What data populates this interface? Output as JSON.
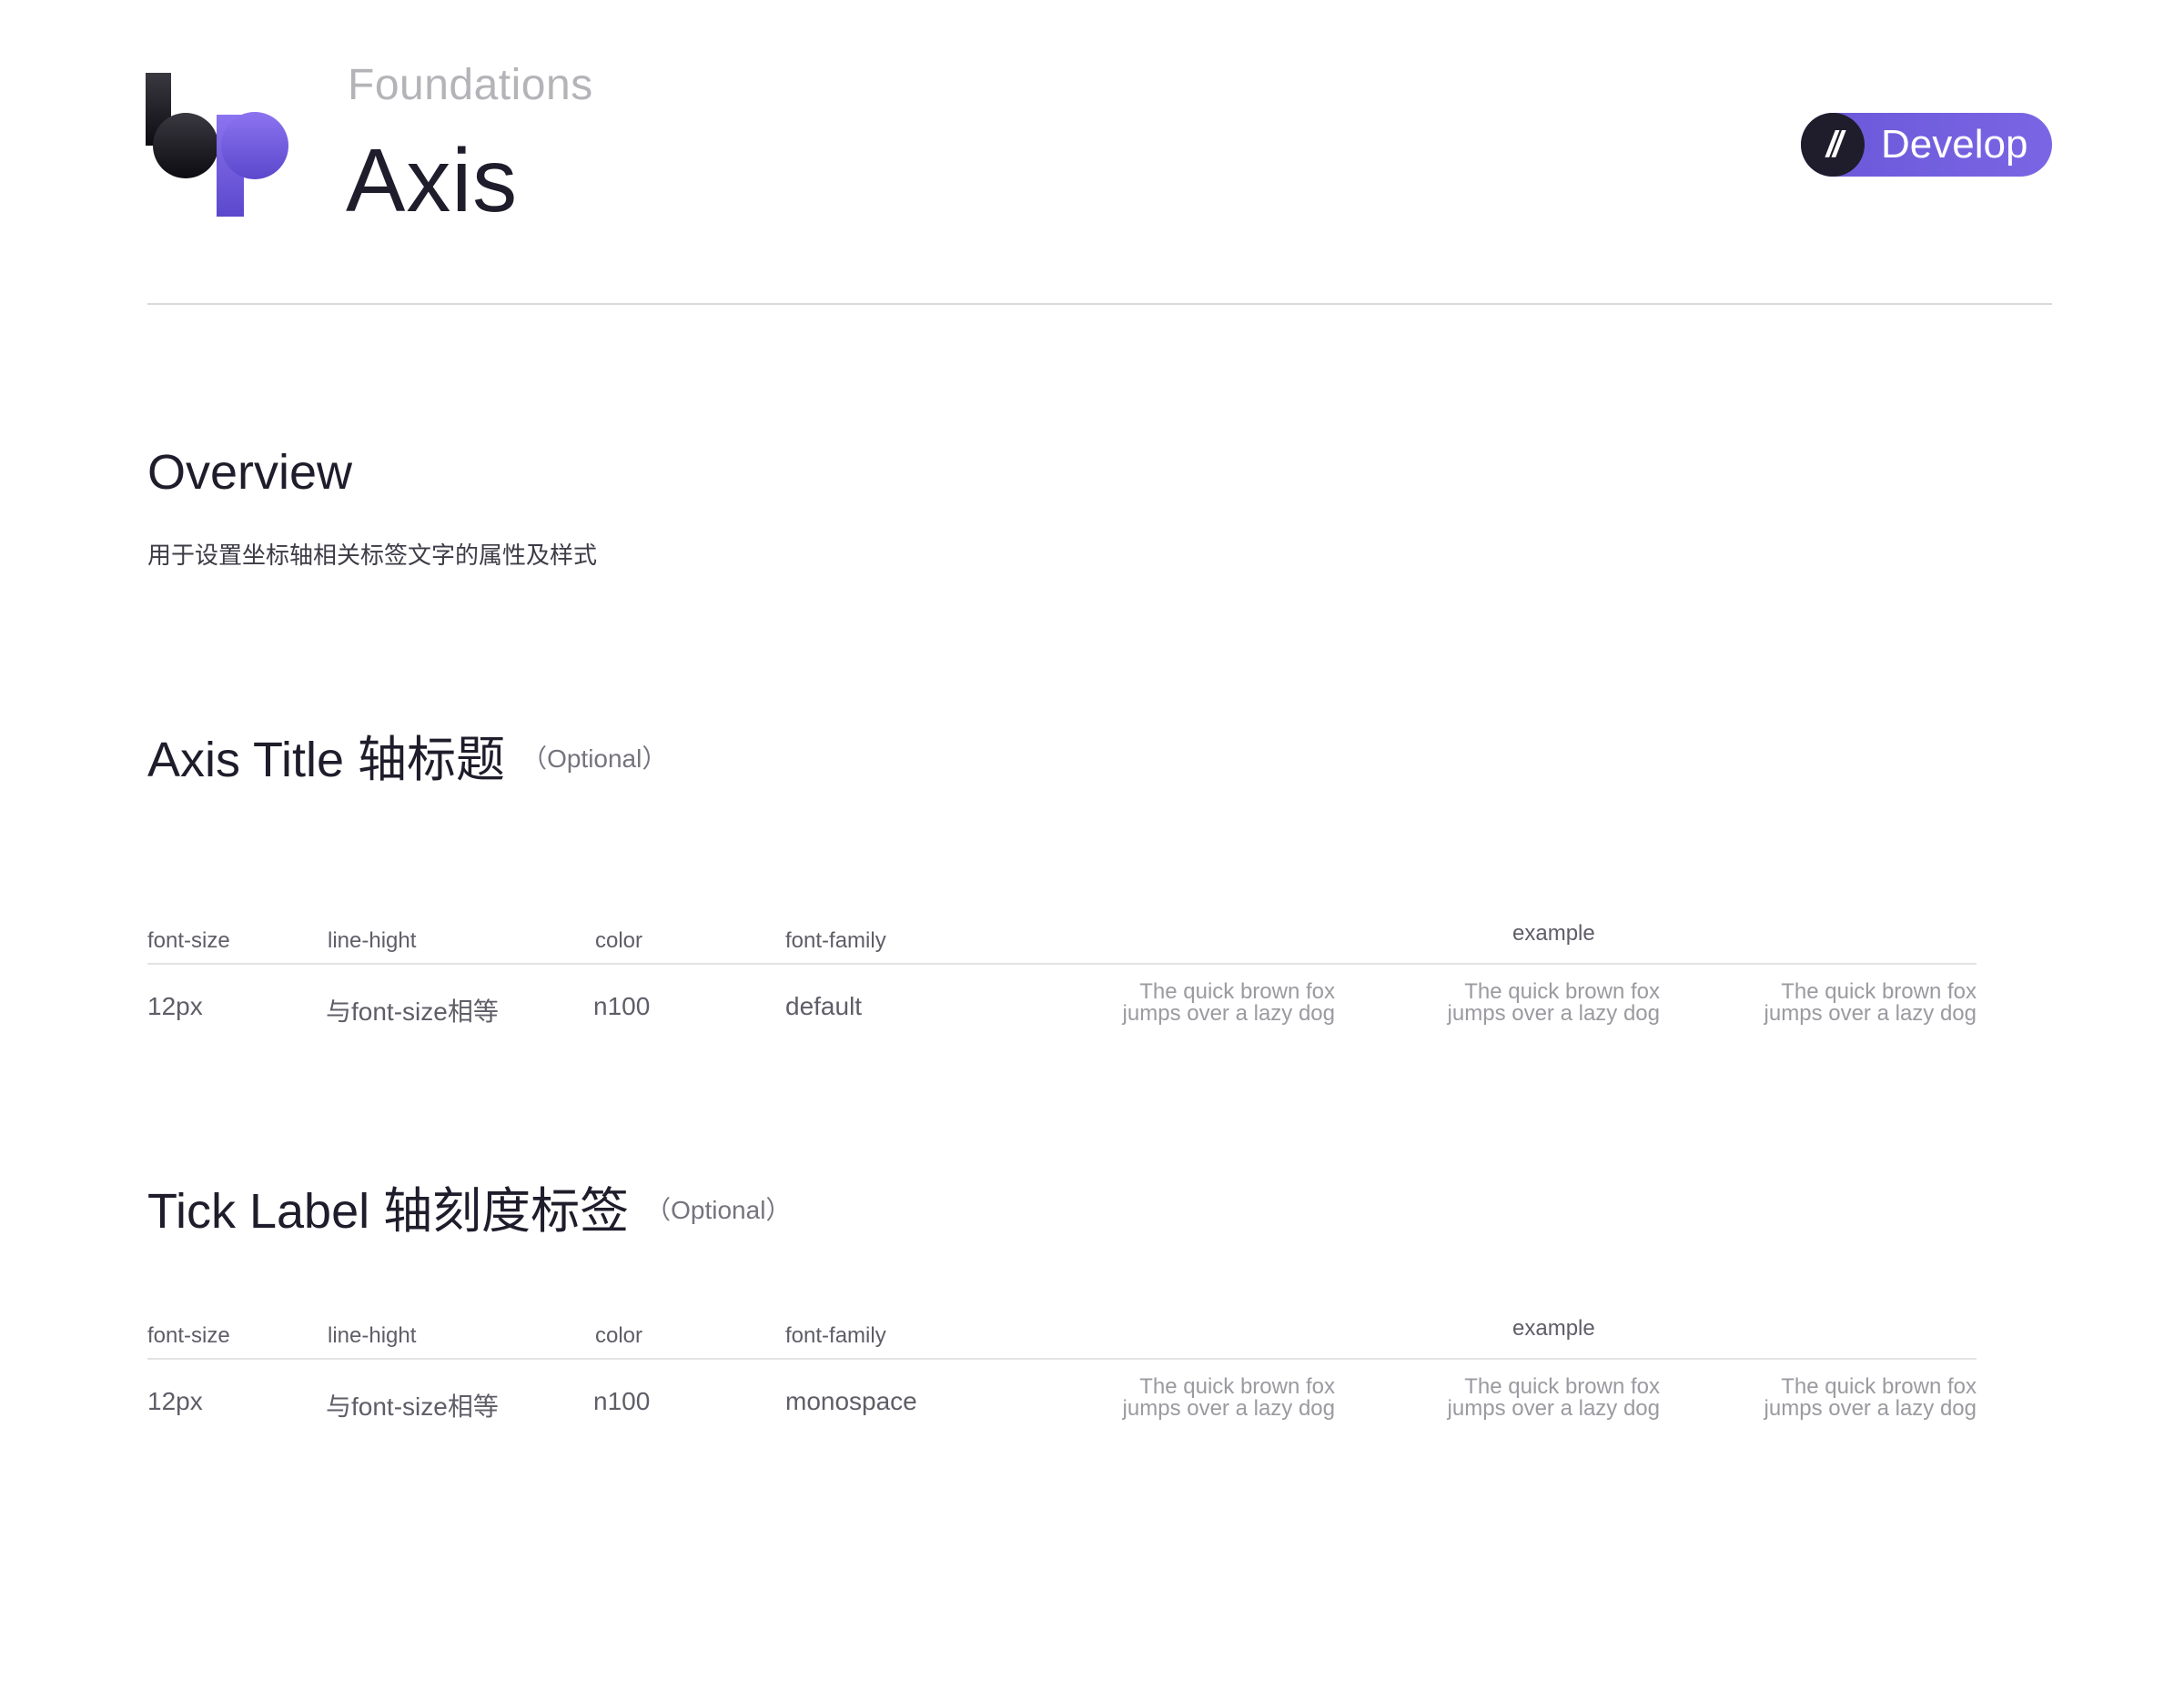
{
  "header": {
    "breadcrumb": "Foundations",
    "title": "Axis",
    "badge_icon": "//",
    "badge_label": "Develop"
  },
  "overview": {
    "heading": "Overview",
    "description": "用于设置坐标轴相关标签文字的属性及样式"
  },
  "sections": [
    {
      "heading": "Axis Title 轴标题",
      "optional": "（Optional）",
      "columns": [
        "font-size",
        "line-hight",
        "color",
        "font-family",
        "example"
      ],
      "row": {
        "font_size": "12px",
        "line_height": "与font-size相等",
        "color": "n100",
        "font_family": "default",
        "examples": [
          [
            "The quick brown fox",
            "jumps over a lazy dog"
          ],
          [
            "The quick brown fox",
            "jumps over a lazy dog"
          ],
          [
            "The quick brown fox",
            "jumps over a lazy dog"
          ]
        ]
      }
    },
    {
      "heading": "Tick Label 轴刻度标签",
      "optional": "（Optional）",
      "columns": [
        "font-size",
        "line-hight",
        "color",
        "font-family",
        "example"
      ],
      "row": {
        "font_size": "12px",
        "line_height": "与font-size相等",
        "color": "n100",
        "font_family": "monospace",
        "examples": [
          [
            "The quick brown fox",
            "jumps over a lazy dog"
          ],
          [
            "The quick brown fox",
            "jumps over a lazy dog"
          ],
          [
            "The quick brown fox",
            "jumps over a lazy dog"
          ]
        ]
      }
    }
  ],
  "colors": {
    "accent": "#6a57d8",
    "ink": "#1f1d2b",
    "muted": "#b4b4b8"
  }
}
